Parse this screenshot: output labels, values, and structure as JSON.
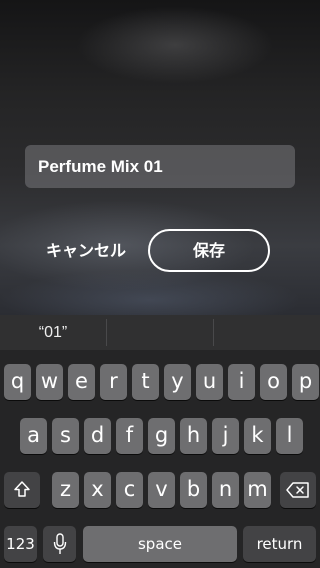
{
  "dialog": {
    "name_value": "Perfume Mix 01",
    "cancel_label": "キャンセル",
    "save_label": "保存"
  },
  "suggestions": [
    "“01”",
    "",
    ""
  ],
  "keyboard": {
    "row1": [
      "q",
      "w",
      "e",
      "r",
      "t",
      "y",
      "u",
      "i",
      "o",
      "p"
    ],
    "row2": [
      "a",
      "s",
      "d",
      "f",
      "g",
      "h",
      "j",
      "k",
      "l"
    ],
    "row3": [
      "z",
      "x",
      "c",
      "v",
      "b",
      "n",
      "m"
    ],
    "numbers_label": "123",
    "space_label": "space",
    "return_label": "return",
    "icons": {
      "shift": "shift-icon",
      "backspace": "backspace-icon",
      "dictation": "microphone-icon"
    }
  },
  "colors": {
    "key": "#6e6e70",
    "function_key": "#434345",
    "keyboard_bg": "#252526"
  }
}
